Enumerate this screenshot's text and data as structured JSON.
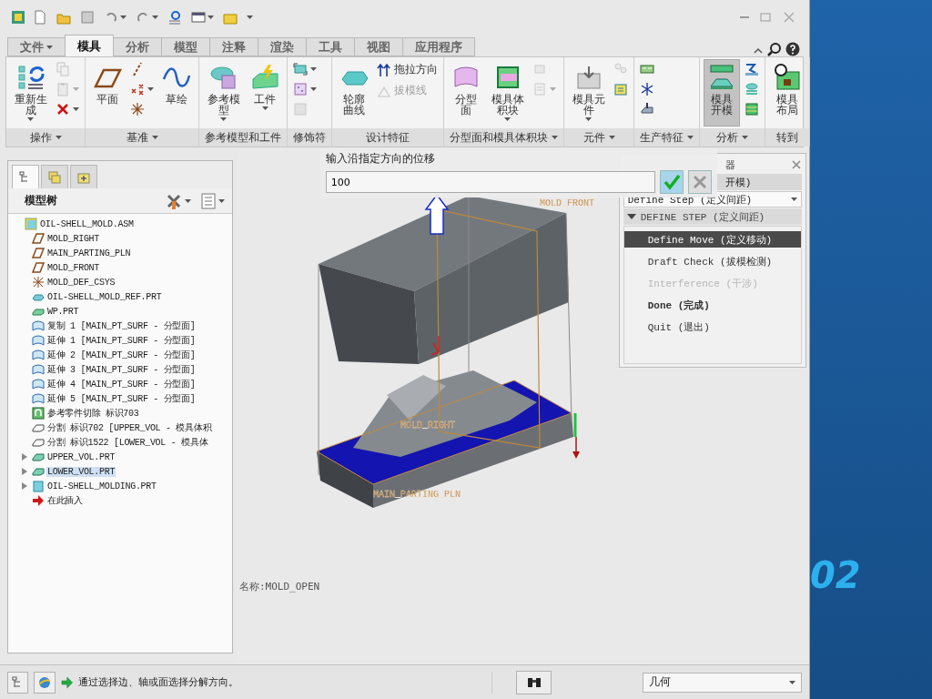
{
  "ribbon": {
    "tabs": [
      {
        "label": "文件",
        "kind": "menu",
        "selected": false
      },
      {
        "label": "模具",
        "kind": "tab",
        "selected": true
      },
      {
        "label": "分析",
        "kind": "tab",
        "selected": false
      },
      {
        "label": "模型",
        "kind": "tab",
        "selected": false
      },
      {
        "label": "注释",
        "kind": "tab",
        "selected": false
      },
      {
        "label": "渲染",
        "kind": "tab",
        "selected": false
      },
      {
        "label": "工具",
        "kind": "tab",
        "selected": false
      },
      {
        "label": "视图",
        "kind": "tab",
        "selected": false
      },
      {
        "label": "应用程序",
        "kind": "tab",
        "selected": false
      }
    ],
    "groups": [
      {
        "label": "操作",
        "menu": true,
        "items": [
          {
            "kind": "large",
            "label": "重新生成",
            "dropdown": true,
            "pressed": false
          },
          {
            "kind": "stack",
            "items": [
              {
                "kind": "small",
                "dropdown": false,
                "disabled": true
              },
              {
                "kind": "small",
                "dropdown": true,
                "disabled": true
              },
              {
                "kind": "small",
                "dropdown": true,
                "disabled": false
              }
            ]
          }
        ]
      },
      {
        "label": "基准",
        "menu": true,
        "items": [
          {
            "kind": "large",
            "label": "平面",
            "dropdown": false,
            "pressed": false
          },
          {
            "kind": "stack",
            "items": [
              {
                "kind": "small",
                "dropdown": false,
                "disabled": false
              },
              {
                "kind": "small",
                "dropdown": true,
                "disabled": false
              },
              {
                "kind": "small",
                "dropdown": false,
                "disabled": false
              }
            ]
          },
          {
            "kind": "large",
            "label": "草绘",
            "dropdown": false,
            "pressed": false
          }
        ]
      },
      {
        "label": "参考模型和工件",
        "menu": false,
        "items": [
          {
            "kind": "large",
            "label": "参考模型",
            "dropdown": true,
            "pressed": false
          },
          {
            "kind": "large",
            "label": "工件",
            "dropdown": true,
            "pressed": false
          }
        ]
      },
      {
        "label": "修饰符",
        "menu": false,
        "items": [
          {
            "kind": "stack",
            "items": [
              {
                "kind": "small",
                "dropdown": true,
                "disabled": false
              },
              {
                "kind": "small",
                "dropdown": true,
                "disabled": false
              },
              {
                "kind": "small",
                "dropdown": false,
                "disabled": true
              }
            ]
          }
        ]
      },
      {
        "label": "设计特征",
        "menu": false,
        "items": [
          {
            "kind": "large",
            "label": "轮廓曲线",
            "dropdown": false,
            "pressed": false
          },
          {
            "kind": "stack",
            "items": [
              {
                "kind": "small_text",
                "label": "拖拉方向",
                "dropdown": false,
                "disabled": false
              },
              {
                "kind": "small_text",
                "label": "拔模线",
                "dropdown": false,
                "disabled": true
              }
            ]
          }
        ]
      },
      {
        "label": "分型面和模具体积块",
        "menu": true,
        "items": [
          {
            "kind": "large",
            "label": "分型面",
            "dropdown": false,
            "pressed": false
          },
          {
            "kind": "large",
            "label": "模具体积块",
            "dropdown": true,
            "pressed": false
          },
          {
            "kind": "stack",
            "items": [
              {
                "kind": "small",
                "dropdown": false,
                "disabled": true
              },
              {
                "kind": "small",
                "dropdown": true,
                "disabled": true
              }
            ]
          }
        ]
      },
      {
        "label": "元件",
        "menu": true,
        "items": [
          {
            "kind": "large",
            "label": "模具元件",
            "dropdown": true,
            "pressed": false
          },
          {
            "kind": "stack",
            "items": [
              {
                "kind": "small",
                "dropdown": false,
                "disabled": true
              },
              {
                "kind": "small",
                "dropdown": false,
                "disabled": false
              }
            ]
          }
        ]
      },
      {
        "label": "生产特征",
        "menu": true,
        "items": [
          {
            "kind": "stack",
            "items": [
              {
                "kind": "small",
                "dropdown": false,
                "disabled": false
              },
              {
                "kind": "small",
                "dropdown": false,
                "disabled": false
              },
              {
                "kind": "small",
                "dropdown": false,
                "disabled": false
              }
            ]
          }
        ]
      },
      {
        "label": "分析",
        "menu": true,
        "items": [
          {
            "kind": "large",
            "label": "模具开模",
            "dropdown": false,
            "pressed": true
          },
          {
            "kind": "stack",
            "items": [
              {
                "kind": "small",
                "dropdown": false,
                "disabled": false
              },
              {
                "kind": "small",
                "dropdown": false,
                "disabled": false
              },
              {
                "kind": "small",
                "dropdown": false,
                "disabled": false
              }
            ]
          }
        ]
      },
      {
        "label": "转到",
        "menu": false,
        "items": [
          {
            "kind": "large",
            "label": "模具布局",
            "dropdown": false,
            "pressed": false
          }
        ]
      }
    ]
  },
  "model_tree": {
    "tabs": [
      {
        "selected": true
      },
      {
        "selected": false
      },
      {
        "selected": false
      }
    ],
    "title": "模型树",
    "root": {
      "label": "OIL-SHELL_MOLD.ASM",
      "kind": "assembly",
      "selected": false,
      "children": [
        {
          "label": "MOLD_RIGHT",
          "kind": "plane",
          "selected": false
        },
        {
          "label": "MAIN_PARTING_PLN",
          "kind": "plane",
          "selected": false
        },
        {
          "label": "MOLD_FRONT",
          "kind": "plane",
          "selected": false
        },
        {
          "label": "MOLD_DEF_CSYS",
          "kind": "csys",
          "selected": false
        },
        {
          "label": "OIL-SHELL_MOLD_REF.PRT",
          "kind": "refpart",
          "selected": false
        },
        {
          "label": "WP.PRT",
          "kind": "workpiece",
          "selected": false
        },
        {
          "label": "复制 1 [MAIN_PT_SURF - 分型面]",
          "kind": "surface",
          "selected": false
        },
        {
          "label": "延伸 1 [MAIN_PT_SURF - 分型面]",
          "kind": "surface",
          "selected": false
        },
        {
          "label": "延伸 2 [MAIN_PT_SURF - 分型面]",
          "kind": "surface",
          "selected": false
        },
        {
          "label": "延伸 3 [MAIN_PT_SURF - 分型面]",
          "kind": "surface",
          "selected": false
        },
        {
          "label": "延伸 4 [MAIN_PT_SURF - 分型面]",
          "kind": "surface",
          "selected": false
        },
        {
          "label": "延伸 5 [MAIN_PT_SURF - 分型面]",
          "kind": "surface",
          "selected": false
        },
        {
          "label": "参考零件切除 标识703",
          "kind": "cut",
          "selected": false
        },
        {
          "label": "分割 标识702 [UPPER_VOL - 模具体积",
          "kind": "split",
          "selected": false
        },
        {
          "label": "分割 标识1522 [LOWER_VOL - 模具体",
          "kind": "split",
          "selected": false
        },
        {
          "label": "UPPER_VOL.PRT",
          "kind": "volume",
          "selected": false,
          "expanded": false
        },
        {
          "label": "LOWER_VOL.PRT",
          "kind": "volume",
          "selected": true,
          "expanded": false
        },
        {
          "label": "OIL-SHELL_MOLDING.PRT",
          "kind": "molding",
          "selected": false,
          "expanded": false
        },
        {
          "label": "在此插入",
          "kind": "insert",
          "selected": false
        }
      ]
    }
  },
  "graphics": {
    "labels": [
      {
        "text": "MOLD_FRONT"
      },
      {
        "text": "MOLD_RIGHT"
      },
      {
        "text": "MAIN_PARTING_PLN"
      }
    ],
    "name_note": "名称:MOLD_OPEN"
  },
  "dialog": {
    "prompt": "输入沿指定方向的位移",
    "value": "100"
  },
  "menu_manager": {
    "title": "器",
    "breadcrumb": "开模)",
    "step_select": "Define Step (定义间距)",
    "section": {
      "label": "DEFINE STEP (定义间距)",
      "expanded": true
    },
    "items": [
      {
        "label": "Define Move (定义移动)",
        "selected": true,
        "disabled": false,
        "emphasized": false
      },
      {
        "label": "Draft Check (拔模检测)",
        "selected": false,
        "disabled": false,
        "emphasized": false
      },
      {
        "label": "Interference (干涉)",
        "selected": false,
        "disabled": true,
        "emphasized": false
      },
      {
        "label": "Done (完成)",
        "selected": false,
        "disabled": false,
        "emphasized": true
      },
      {
        "label": "Quit (退出)",
        "selected": false,
        "disabled": false,
        "emphasized": false
      }
    ]
  },
  "status_bar": {
    "message": "通过选择边、轴或面选择分解方向。",
    "filter": "几何"
  },
  "desktop": {
    "caption": "02"
  }
}
